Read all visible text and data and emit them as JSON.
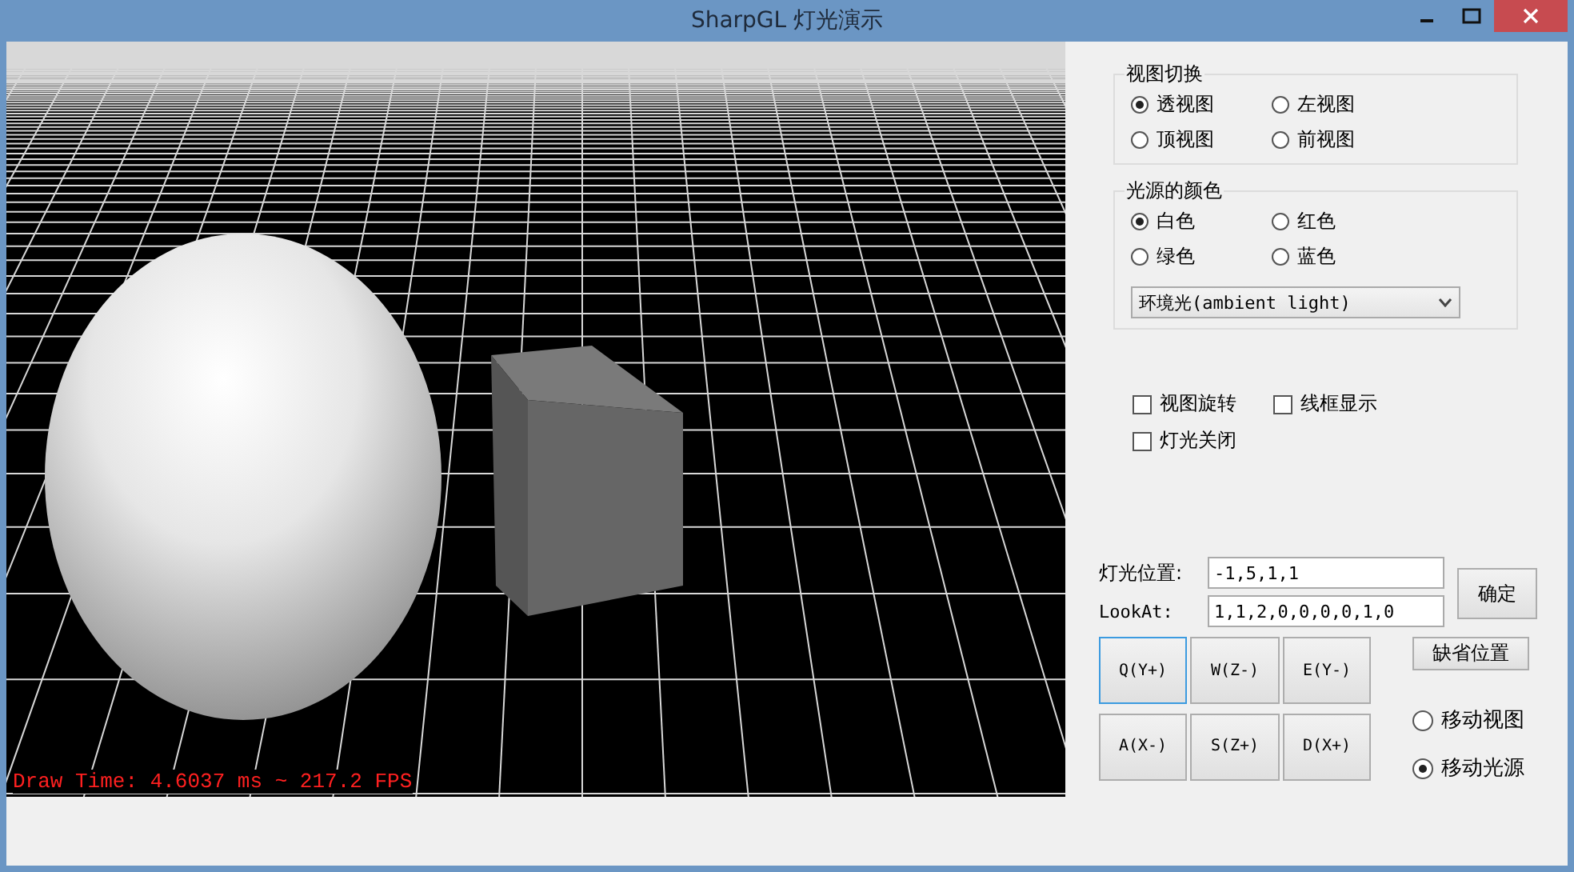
{
  "window": {
    "title": "SharpGL 灯光演示"
  },
  "viewport": {
    "status_text": "Draw Time: 4.6037 ms ~ 217.2 FPS"
  },
  "view_group": {
    "title": "视图切换",
    "options": [
      {
        "label": "透视图",
        "selected": true
      },
      {
        "label": "左视图",
        "selected": false
      },
      {
        "label": "顶视图",
        "selected": false
      },
      {
        "label": "前视图",
        "selected": false
      }
    ]
  },
  "light_color_group": {
    "title": "光源的颜色",
    "options": [
      {
        "label": "白色",
        "selected": true
      },
      {
        "label": "红色",
        "selected": false
      },
      {
        "label": "绿色",
        "selected": false
      },
      {
        "label": "蓝色",
        "selected": false
      }
    ],
    "light_type": {
      "value": "环境光(ambient light)"
    }
  },
  "checkboxes": [
    {
      "label": "视图旋转",
      "checked": false
    },
    {
      "label": "线框显示",
      "checked": false
    },
    {
      "label": "灯光关闭",
      "checked": false
    }
  ],
  "light_position": {
    "label": "灯光位置:",
    "value": "-1,5,1,1"
  },
  "look_at": {
    "label": "LookAt:",
    "value": "1,1,2,0,0,0,0,1,0"
  },
  "confirm_button": "确定",
  "default_position_button": "缺省位置",
  "move_buttons": [
    {
      "label": "Q(Y+)",
      "focused": true
    },
    {
      "label": "W(Z-)",
      "focused": false
    },
    {
      "label": "E(Y-)",
      "focused": false
    },
    {
      "label": "A(X-)",
      "focused": false
    },
    {
      "label": "S(Z+)",
      "focused": false
    },
    {
      "label": "D(X+)",
      "focused": false
    }
  ],
  "move_mode": [
    {
      "label": "移动视图",
      "selected": false
    },
    {
      "label": "移动光源",
      "selected": true
    }
  ]
}
